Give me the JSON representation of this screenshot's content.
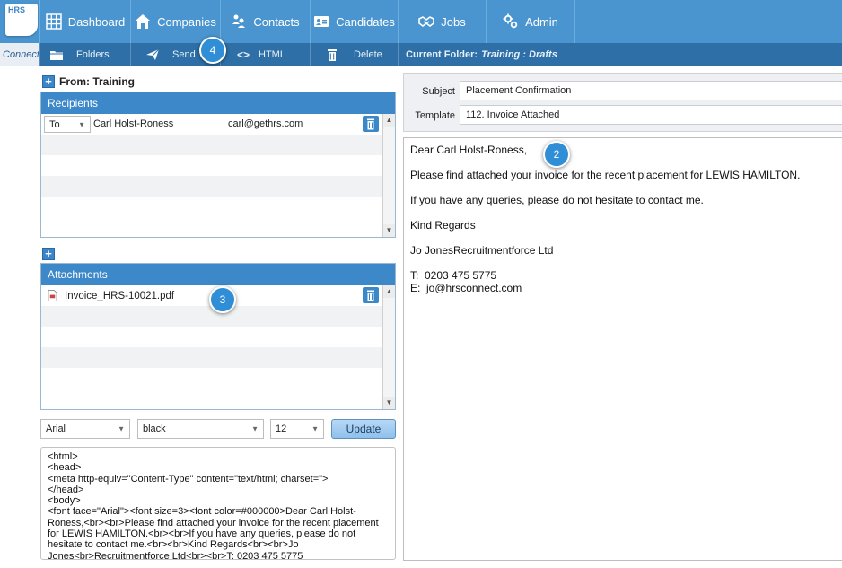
{
  "app": {
    "logo_text": "HRS",
    "brand_sub": "Connect"
  },
  "nav": {
    "items": [
      {
        "label": "Dashboard",
        "icon": "grid-icon"
      },
      {
        "label": "Companies",
        "icon": "building-icon"
      },
      {
        "label": "Contacts",
        "icon": "people-icon"
      },
      {
        "label": "Candidates",
        "icon": "id-card-icon"
      },
      {
        "label": "Jobs",
        "icon": "handshake-icon"
      },
      {
        "label": "Admin",
        "icon": "gears-icon"
      }
    ]
  },
  "toolbar": {
    "folders_label": "Folders",
    "send_label": "Send",
    "html_label": "HTML",
    "delete_label": "Delete",
    "current_folder_label": "Current Folder:",
    "current_folder_value": "Training : Drafts"
  },
  "badges": {
    "send_step": "4",
    "body_step": "2",
    "attachments_step": "3"
  },
  "from": {
    "label": "From: Training"
  },
  "recipients": {
    "title": "Recipients",
    "rows": [
      {
        "type": "To",
        "name": "Carl Holst-Roness",
        "email": "carl@gethrs.com"
      }
    ]
  },
  "attachments": {
    "title": "Attachments",
    "files": [
      {
        "name": "Invoice_HRS-10021.pdf"
      }
    ]
  },
  "format": {
    "font": "Arial",
    "color": "black",
    "size": "12",
    "update_label": "Update"
  },
  "source_html": "<html>\n<head>\n<meta http-equiv=\"Content-Type\" content=\"text/html; charset=\">\n</head>\n<body>\n<font face=\"Arial\"><font size=3><font color=#000000>Dear Carl Holst-Roness,<br><br>Please find attached your invoice for the recent placement for LEWIS HAMILTON.<br><br>If you have any queries, please do not hesitate to contact me.<br><br>Kind Regards<br><br>Jo Jones<br>Recruitmentforce Ltd<br><br>T: 0203 475 5775",
  "message": {
    "subject_label": "Subject",
    "subject_value": "Placement Confirmation",
    "template_label": "Template",
    "template_value": "112. Invoice Attached"
  },
  "body": {
    "greeting": "Dear Carl Holst-Roness,",
    "line1": "Please find attached your invoice for the recent placement for LEWIS HAMILTON.",
    "line2": "If you have any queries, please do not hesitate to contact me.",
    "closing": "Kind Regards",
    "signature": "Jo JonesRecruitmentforce Ltd",
    "phone": "T:  0203 475 5775",
    "email": "E:  jo@hrsconnect.com"
  },
  "colors": {
    "nav_bg": "#4a95cf",
    "subbar_bg": "#2e6fa7",
    "panel_header": "#3c88c9",
    "badge": "#2f8ed6"
  }
}
